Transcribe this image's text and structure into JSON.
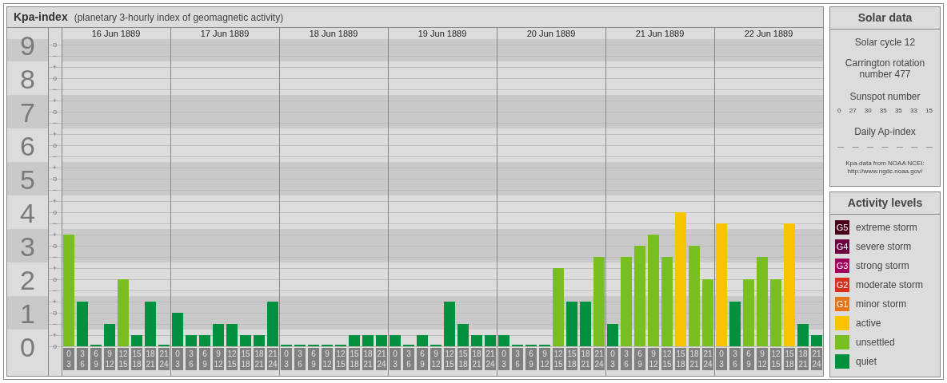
{
  "panel": {
    "title": "Kpa-index",
    "subtitle": "(planetary 3-hourly index of geomagnetic activity)"
  },
  "days": [
    "16 Jun 1889",
    "17 Jun 1889",
    "18 Jun 1889",
    "19 Jun 1889",
    "20 Jun 1889",
    "21 Jun 1889",
    "22 Jun 1889"
  ],
  "minor_ticks": [
    "o",
    "−",
    "+",
    "o",
    "−",
    "+",
    "o",
    "−",
    "+",
    "o",
    "−",
    "+",
    "o",
    "−",
    "+",
    "o",
    "−",
    "+",
    "o",
    "−",
    "+",
    "o",
    "−",
    "+",
    "o",
    "−",
    "+",
    "o"
  ],
  "chart_data": {
    "type": "bar",
    "yticks": [
      0,
      1,
      2,
      3,
      4,
      5,
      6,
      7,
      8,
      9
    ],
    "ylim": [
      -0.88,
      9.5
    ],
    "grid": true,
    "categories": [
      "0 3",
      "3 6",
      "6 9",
      "9 12",
      "12 15",
      "15 18",
      "18 21",
      "21 24",
      "0 3",
      "3 6",
      "6 9",
      "9 12",
      "12 15",
      "15 18",
      "18 21",
      "21 24",
      "0 3",
      "3 6",
      "6 9",
      "9 12",
      "12 15",
      "15 18",
      "18 21",
      "21 24",
      "0 3",
      "3 6",
      "6 9",
      "9 12",
      "12 15",
      "15 18",
      "18 21",
      "21 24",
      "0 3",
      "3 6",
      "6 9",
      "9 12",
      "12 15",
      "15 18",
      "18 21",
      "21 24",
      "0 3",
      "3 6",
      "6 9",
      "9 12",
      "12 15",
      "15 18",
      "18 21",
      "21 24",
      "0 3",
      "3 6",
      "6 9",
      "9 12",
      "12 15",
      "15 18",
      "18 21",
      "21 24"
    ],
    "values": [
      3.33,
      1.33,
      0,
      0.67,
      2,
      0.33,
      1.33,
      0,
      1,
      0.33,
      0.33,
      0.67,
      0.67,
      0.33,
      0.33,
      1.33,
      0,
      0,
      0,
      0,
      0,
      0.33,
      0.33,
      0.33,
      0.33,
      0,
      0.33,
      0,
      1.33,
      0.67,
      0.33,
      0.33,
      0.33,
      0,
      0,
      0,
      2.33,
      1.33,
      1.33,
      2.67,
      0.67,
      2.67,
      3,
      3.33,
      2.67,
      4,
      3,
      2,
      3.67,
      1.33,
      2,
      2.67,
      2,
      3.67,
      0.67,
      0.33
    ]
  },
  "solar_data": {
    "title": "Solar data",
    "solar_cycle": "Solar cycle 12",
    "carrington": "Carrington rotation number 477",
    "sunspot_title": "Sunspot number",
    "sunspots": [
      "0",
      "27",
      "30",
      "35",
      "35",
      "33",
      "15"
    ],
    "ap_title": "Daily Ap-index",
    "ap_values": [
      "—",
      "—",
      "—",
      "—",
      "—",
      "—",
      "—"
    ],
    "source": [
      "Kpa-data from NOAA NCEI:",
      "http://www.ngdc.noaa.gov/"
    ]
  },
  "activity_levels": {
    "title": "Activity levels",
    "items": [
      {
        "badge": "G5",
        "label": "extreme storm",
        "color": "#4b0019"
      },
      {
        "badge": "G4",
        "label": "severe storm",
        "color": "#6c0040"
      },
      {
        "badge": "G3",
        "label": "strong storm",
        "color": "#a3005c"
      },
      {
        "badge": "G2",
        "label": "moderate storm",
        "color": "#d6301c"
      },
      {
        "badge": "G1",
        "label": "minor storm",
        "color": "#e5761b"
      },
      {
        "label": "active",
        "color": "#f8c400"
      },
      {
        "label": "unsettled",
        "color": "#7abf21"
      },
      {
        "label": "quiet",
        "color": "#00903e"
      }
    ]
  }
}
